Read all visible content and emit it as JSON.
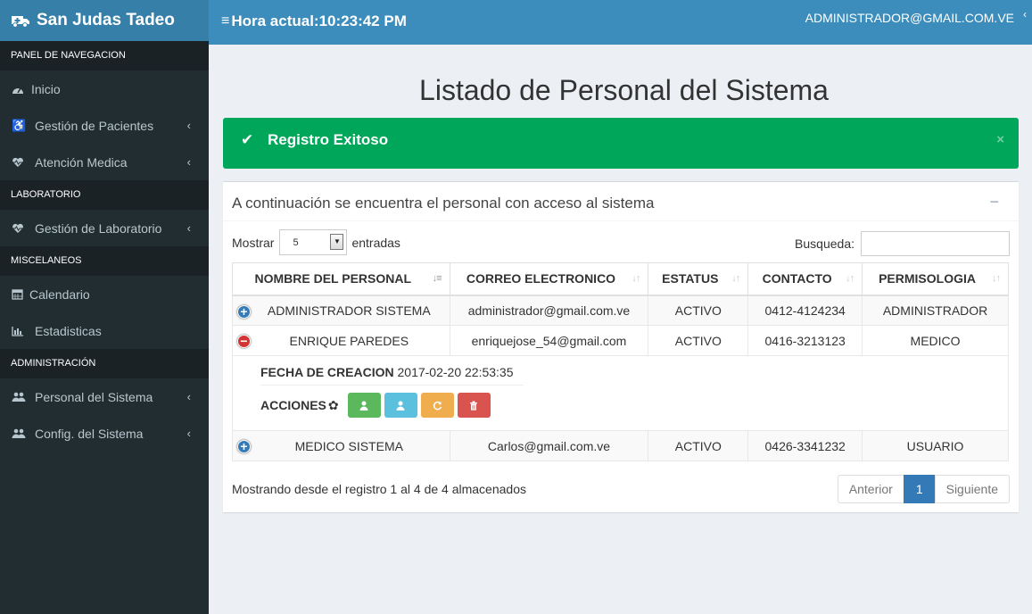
{
  "app": {
    "name": "San Judas Tadeo"
  },
  "header": {
    "clock_label": "Hora actual:10:23:42 PM",
    "user_email": "ADMINISTRADOR@GMAIL.COM.VE"
  },
  "sidebar": {
    "sections": [
      "PANEL DE NAVEGACION",
      "LABORATORIO",
      "MISCELANEOS",
      "ADMINISTRACIÓN"
    ],
    "items": [
      {
        "label": "Inicio",
        "icon": "dashboard-icon"
      },
      {
        "label": "Gestión de Pacientes",
        "icon": "wheelchair-icon"
      },
      {
        "label": "Atención Medica",
        "icon": "heartbeat-icon"
      },
      {
        "label": "Gestión de Laboratorio",
        "icon": "heartbeat-icon"
      },
      {
        "label": "Calendario",
        "icon": "calendar-icon"
      },
      {
        "label": "Estadisticas",
        "icon": "bar-chart-icon"
      },
      {
        "label": "Personal del Sistema",
        "icon": "users-icon"
      },
      {
        "label": "Config. del Sistema",
        "icon": "users-icon"
      }
    ]
  },
  "page": {
    "title": "Listado de Personal del Sistema"
  },
  "alert": {
    "message": "Registro Exitoso",
    "close": "×",
    "color": "#00a65a"
  },
  "box": {
    "title": "A continuación se encuentra el personal con acceso al sistema",
    "collapse": "−"
  },
  "datatable": {
    "length_prefix": "Mostrar",
    "length_value": "5",
    "length_suffix": "entradas",
    "search_label": "Busqueda:",
    "search_value": "",
    "columns": [
      "NOMBRE DEL PERSONAL",
      "CORREO ELECTRONICO",
      "ESTATUS",
      "CONTACTO",
      "PERMISOLOGIA"
    ],
    "rows": [
      {
        "name": "ADMINISTRADOR SISTEMA",
        "email": "administrador@gmail.com.ve",
        "status": "ACTIVO",
        "contact": "0412-4124234",
        "role": "ADMINISTRADOR"
      },
      {
        "name": "ENRIQUE PAREDES",
        "email": "enriquejose_54@gmail.com",
        "status": "ACTIVO",
        "contact": "0416-3213123",
        "role": "MEDICO"
      },
      {
        "name": "MEDICO SISTEMA",
        "email": "Carlos@gmail.com.ve",
        "status": "ACTIVO",
        "contact": "0426-3341232",
        "role": "USUARIO"
      }
    ],
    "child": {
      "created_label": "FECHA DE CREACION",
      "created_value": "2017-02-20 22:53:35",
      "actions_label": "ACCIONES"
    },
    "info": "Mostrando desde el registro 1 al 4 de 4 almacenados",
    "pagination": {
      "prev": "Anterior",
      "current": "1",
      "next": "Siguiente"
    }
  }
}
